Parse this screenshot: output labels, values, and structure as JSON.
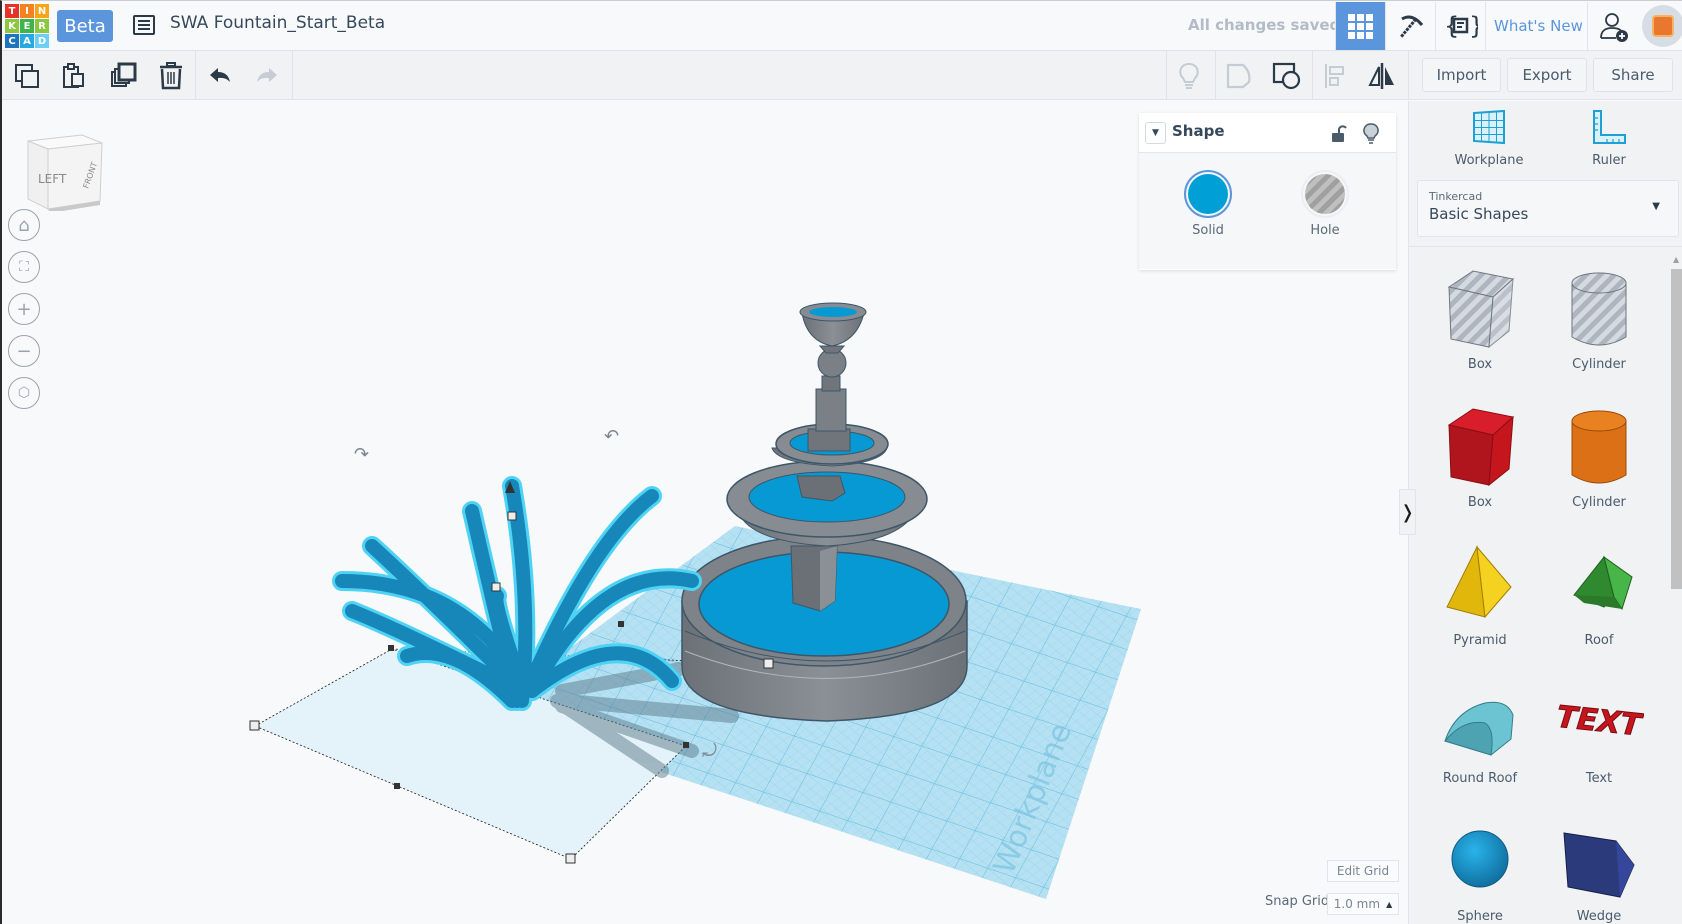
{
  "app": {
    "logo_letters": [
      "T",
      "I",
      "N",
      "K",
      "E",
      "R",
      "C",
      "A",
      "D"
    ],
    "logo_colors": [
      "#e5332a",
      "#f58220",
      "#f9a51a",
      "#8dc63f",
      "#3db54a",
      "#8dc63f",
      "#1f75bc",
      "#29a8e0",
      "#6dcff6"
    ],
    "beta_label": "Beta",
    "document_title": "SWA Fountain_Start_Beta",
    "save_status": "All changes saved",
    "whats_new": "What's New",
    "accent_color": "#5b96dc"
  },
  "topbar_icons": {
    "file_list": "list-icon",
    "grid_view": "grid-view-icon",
    "minecraft": "pickaxe-icon",
    "codeblocks": "code-blocks-icon",
    "add_user": "add-user-icon",
    "avatar": "user-avatar"
  },
  "toolbar": {
    "left_tools": [
      "copy-icon",
      "paste-icon",
      "duplicate-icon",
      "delete-icon",
      "undo-icon",
      "redo-icon"
    ],
    "right_tools": [
      "show-all-icon",
      "note-icon",
      "group-icon",
      "align-icon",
      "mirror-icon"
    ],
    "import_label": "Import",
    "export_label": "Export",
    "share_label": "Share"
  },
  "viewcube": {
    "face_left": "LEFT",
    "face_front": "FRONT"
  },
  "nav_controls": [
    "home-view",
    "fit-all",
    "zoom-in",
    "zoom-out",
    "perspective-toggle"
  ],
  "shape_panel": {
    "title": "Shape",
    "solid_label": "Solid",
    "hole_label": "Hole",
    "selected": "Solid",
    "solid_color": "#00a0d6"
  },
  "right_panel": {
    "workplane_label": "Workplane",
    "ruler_label": "Ruler",
    "library_provider": "Tinkercad",
    "library_name": "Basic Shapes",
    "shapes": [
      {
        "label": "Box",
        "kind": "box-hole",
        "color": "#c7ccd3"
      },
      {
        "label": "Cylinder",
        "kind": "cylinder-hole",
        "color": "#c7ccd3"
      },
      {
        "label": "Box",
        "kind": "box",
        "color": "#c4161c"
      },
      {
        "label": "Cylinder",
        "kind": "cylinder",
        "color": "#e8761b"
      },
      {
        "label": "Pyramid",
        "kind": "pyramid",
        "color": "#f0c419"
      },
      {
        "label": "Roof",
        "kind": "roof",
        "color": "#3aa13a"
      },
      {
        "label": "Round Roof",
        "kind": "round-roof",
        "color": "#5bbfcc"
      },
      {
        "label": "Text",
        "kind": "text",
        "color": "#c4161c"
      },
      {
        "label": "Sphere",
        "kind": "sphere",
        "color": "#1a9ad6"
      },
      {
        "label": "Wedge",
        "kind": "wedge",
        "color": "#2a3a7a"
      }
    ]
  },
  "workplane": {
    "watermark": "Workplane",
    "edit_grid_label": "Edit Grid",
    "snap_grid_label": "Snap Grid",
    "snap_grid_value": "1.0 mm"
  }
}
